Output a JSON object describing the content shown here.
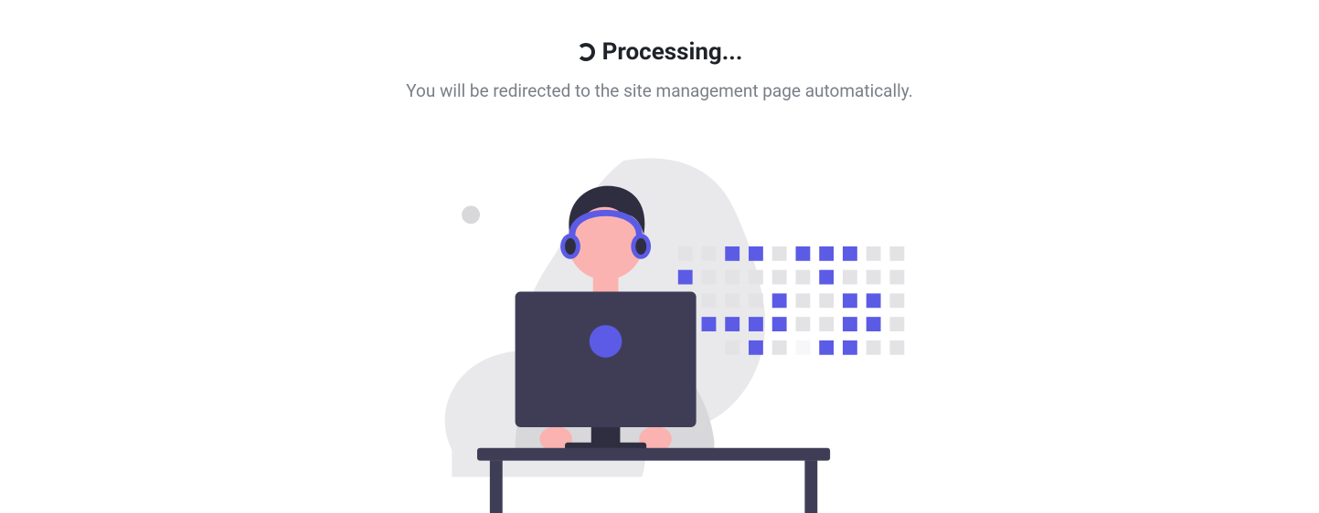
{
  "status": {
    "title": "Processing...",
    "subtitle": "You will be redirected to the site management page automatically."
  }
}
